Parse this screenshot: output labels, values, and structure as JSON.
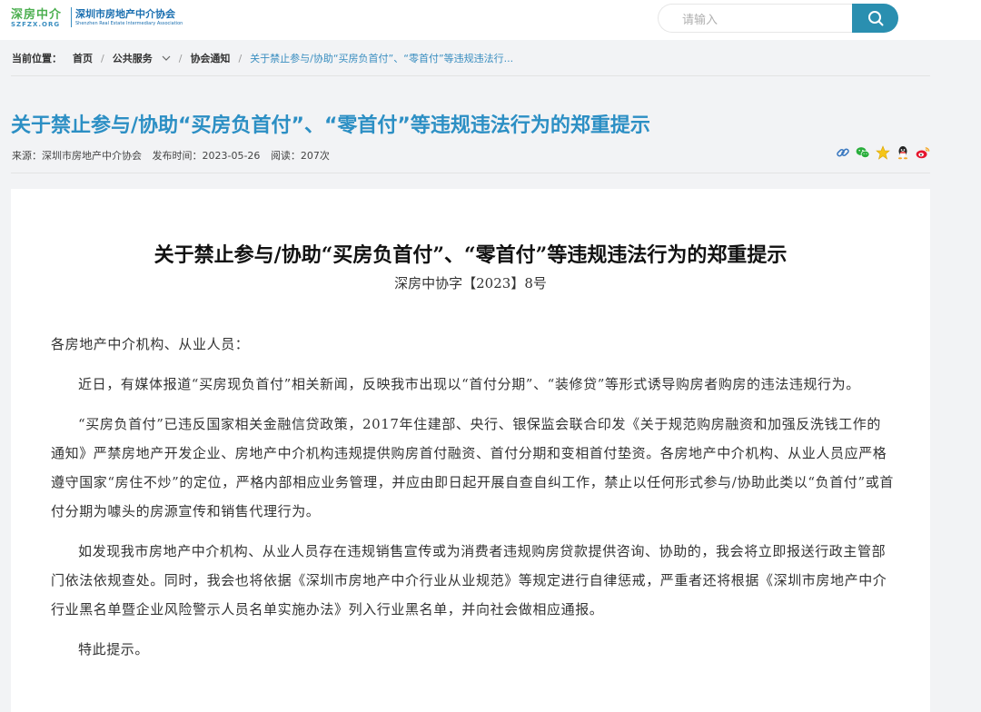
{
  "header": {
    "logo": {
      "mark_text": "深房中介",
      "mark_sub": "SZFZX.ORG",
      "name_cn": "深圳市房地产中介协会",
      "name_en": "Shenzhen Real Estate Intermediary Association"
    },
    "search": {
      "placeholder": "请输入",
      "button_icon": "search-icon"
    },
    "colors": {
      "accent": "#2a8fb0",
      "title": "#2c8fc4"
    }
  },
  "breadcrumb": {
    "prefix": "当前位置：",
    "items": [
      "首页",
      "公共服务",
      "协会通知"
    ],
    "current": "关于禁止参与/协助“买房负首付”、“零首付”等违规违法行..."
  },
  "article_header": {
    "title": "关于禁止参与/协助“买房负首付”、“零首付”等违规违法行为的郑重提示",
    "source": "来源：深圳市房地产中介协会",
    "published": "发布时间：2023-05-26",
    "reads": "阅读：207次",
    "share_icons": [
      "link-icon",
      "wechat-icon",
      "star-icon",
      "qq-icon",
      "weibo-icon"
    ]
  },
  "article": {
    "doc_title": "关于禁止参与/协助“买房负首付”、“零首付”等违规违法行为的郑重提示",
    "doc_number": "深房中协字【2023】8号",
    "salutation": "各房地产中介机构、从业人员：",
    "paragraphs": [
      "近日，有媒体报道“买房现负首付”相关新闻，反映我市出现以“首付分期”、“装修贷”等形式诱导购房者购房的违法违规行为。",
      "“买房负首付”已违反国家相关金融信贷政策，2017年住建部、央行、银保监会联合印发《关于规范购房融资和加强反洗钱工作的通知》严禁房地产开发企业、房地产中介机构违规提供购房首付融资、首付分期和变相首付垫资。各房地产中介机构、从业人员应严格遵守国家“房住不炒”的定位，严格内部相应业务管理，并应由即日起开展自查自纠工作，禁止以任何形式参与/协助此类以“负首付”或首付分期为噱头的房源宣传和销售代理行为。",
      "如发现我市房地产中介机构、从业人员存在违规销售宣传或为消费者违规购房贷款提供咨询、协助的，我会将立即报送行政主管部门依法依规查处。同时，我会也将依据《深圳市房地产中介行业从业规范》等规定进行自律惩戒，严重者还将根据《深圳市房地产中介行业黑名单暨企业风险警示人员名单实施办法》列入行业黑名单，并向社会做相应通报。"
    ],
    "closing": "特此提示。"
  }
}
